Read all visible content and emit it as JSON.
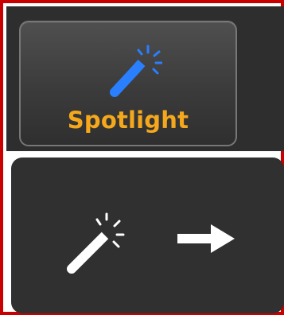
{
  "spotlight_button": {
    "label": "Spotlight",
    "icon": "magic-wand-icon",
    "label_color": "#f5a81c",
    "icon_color": "#2a7fff"
  },
  "gesture_card": {
    "icons": [
      "magic-wand-icon",
      "arrow-right-icon"
    ],
    "icon_color": "#ffffff"
  },
  "frame": {
    "border_color": "#c80000"
  }
}
